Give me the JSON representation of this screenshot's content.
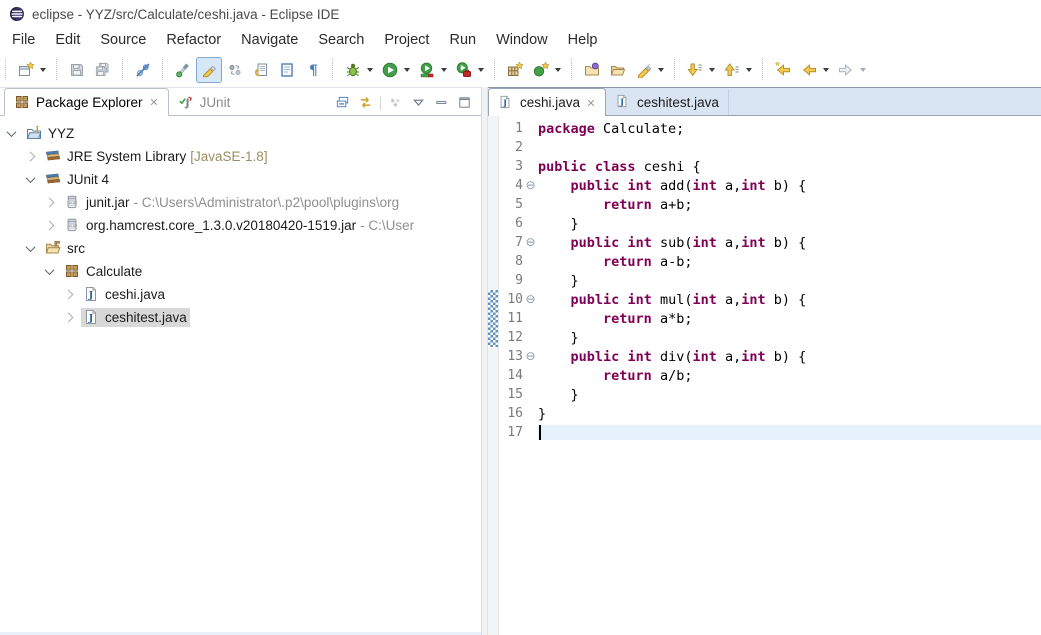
{
  "window": {
    "title": "eclipse - YYZ/src/Calculate/ceshi.java - Eclipse IDE"
  },
  "menubar": [
    "File",
    "Edit",
    "Source",
    "Refactor",
    "Navigate",
    "Search",
    "Project",
    "Run",
    "Window",
    "Help"
  ],
  "toolbar": {
    "groups": [
      [
        {
          "name": "new-wizard-icon",
          "dropdown": true
        }
      ],
      [
        {
          "name": "save-icon",
          "disabled": true
        },
        {
          "name": "save-all-icon",
          "disabled": true
        }
      ],
      [
        {
          "name": "skip-breakpoints-icon"
        }
      ],
      [
        {
          "name": "flashlight-icon"
        },
        {
          "name": "mark-occurrences-icon",
          "active": true
        },
        {
          "name": "linked-dots-icon"
        },
        {
          "name": "page-arrow-icon"
        },
        {
          "name": "framed-page-icon"
        },
        {
          "name": "pilcrow-icon"
        }
      ],
      [
        {
          "name": "debug-icon",
          "dropdown": true
        },
        {
          "name": "run-icon",
          "dropdown": true
        },
        {
          "name": "coverage-icon",
          "dropdown": true
        },
        {
          "name": "external-tools-icon",
          "dropdown": true
        }
      ],
      [
        {
          "name": "new-java-project-icon"
        },
        {
          "name": "new-class-icon",
          "dropdown": true
        }
      ],
      [
        {
          "name": "open-type-icon"
        },
        {
          "name": "open-folder-icon"
        },
        {
          "name": "search-icon",
          "dropdown": true
        }
      ],
      [
        {
          "name": "next-annotation-icon",
          "dropdown": true
        },
        {
          "name": "previous-annotation-icon",
          "dropdown": true
        }
      ],
      [
        {
          "name": "last-edit-location-icon"
        },
        {
          "name": "back-icon",
          "dropdown": true
        },
        {
          "name": "forward-icon",
          "dropdown": true,
          "disabled": true
        }
      ]
    ]
  },
  "package_explorer": {
    "tabs": [
      {
        "label": "Package Explorer",
        "icon": "package-explorer-icon",
        "active": true,
        "closable": true
      },
      {
        "label": "JUnit",
        "icon": "junit-icon",
        "active": false
      }
    ],
    "view_buttons": [
      {
        "name": "collapse-all-icon"
      },
      {
        "name": "link-with-editor-icon"
      },
      {
        "sep": true
      },
      {
        "name": "focus-icon",
        "disabled": true
      },
      {
        "name": "view-menu-icon"
      },
      {
        "name": "minimize-icon"
      },
      {
        "name": "maximize-icon"
      }
    ],
    "tree": [
      {
        "label": "YYZ",
        "icon": "java-project-icon",
        "level": 0,
        "expanded": true
      },
      {
        "label": "JRE System Library",
        "decor": " [JavaSE-1.8]",
        "icon": "library-icon",
        "level": 1,
        "expanded": false
      },
      {
        "label": "JUnit 4",
        "icon": "library-icon",
        "level": 1,
        "expanded": true
      },
      {
        "label": "junit.jar",
        "qualifier": " - C:\\Users\\Administrator\\.p2\\pool\\plugins\\org",
        "icon": "jar-icon",
        "level": 2,
        "expanded": false
      },
      {
        "label": "org.hamcrest.core_1.3.0.v20180420-1519.jar",
        "qualifier": " - C:\\User",
        "icon": "jar-icon",
        "level": 2,
        "expanded": false
      },
      {
        "label": "src",
        "icon": "src-folder-icon",
        "level": 1,
        "expanded": true
      },
      {
        "label": "Calculate",
        "icon": "package-icon",
        "level": 2,
        "expanded": true
      },
      {
        "label": "ceshi.java",
        "icon": "java-file-icon",
        "level": 3,
        "expanded": false
      },
      {
        "label": "ceshitest.java",
        "icon": "java-file-icon",
        "level": 3,
        "expanded": false,
        "selected": true
      }
    ]
  },
  "editor": {
    "tabs": [
      {
        "label": "ceshi.java",
        "icon": "java-file-icon",
        "active": true,
        "closable": true
      },
      {
        "label": "ceshitest.java",
        "icon": "java-file-icon",
        "active": false
      }
    ],
    "cursor_line": 17,
    "current_line": 17,
    "fold_lines": [
      4,
      7,
      10,
      13
    ],
    "range_indicator": {
      "from": 10,
      "to": 12
    },
    "lines": [
      {
        "segs": [
          [
            "package",
            "k"
          ],
          [
            " Calculate;",
            "p"
          ]
        ]
      },
      {
        "segs": []
      },
      {
        "segs": [
          [
            "public",
            "k"
          ],
          [
            " ",
            "p"
          ],
          [
            "class",
            "k"
          ],
          [
            " ceshi {",
            "p"
          ]
        ]
      },
      {
        "segs": [
          [
            "    ",
            "p"
          ],
          [
            "public",
            "k"
          ],
          [
            " ",
            "p"
          ],
          [
            "int",
            "k"
          ],
          [
            " add(",
            "p"
          ],
          [
            "int",
            "k"
          ],
          [
            " a,",
            "p"
          ],
          [
            "int",
            "k"
          ],
          [
            " b) {",
            "p"
          ]
        ]
      },
      {
        "segs": [
          [
            "        ",
            "p"
          ],
          [
            "return",
            "k"
          ],
          [
            " a+b;",
            "p"
          ]
        ]
      },
      {
        "segs": [
          [
            "    }",
            "p"
          ]
        ]
      },
      {
        "segs": [
          [
            "    ",
            "p"
          ],
          [
            "public",
            "k"
          ],
          [
            " ",
            "p"
          ],
          [
            "int",
            "k"
          ],
          [
            " sub(",
            "p"
          ],
          [
            "int",
            "k"
          ],
          [
            " a,",
            "p"
          ],
          [
            "int",
            "k"
          ],
          [
            " b) {",
            "p"
          ]
        ]
      },
      {
        "segs": [
          [
            "        ",
            "p"
          ],
          [
            "return",
            "k"
          ],
          [
            " a-b;",
            "p"
          ]
        ]
      },
      {
        "segs": [
          [
            "    }",
            "p"
          ]
        ]
      },
      {
        "segs": [
          [
            "    ",
            "p"
          ],
          [
            "public",
            "k"
          ],
          [
            " ",
            "p"
          ],
          [
            "int",
            "k"
          ],
          [
            " mul(",
            "p"
          ],
          [
            "int",
            "k"
          ],
          [
            " a,",
            "p"
          ],
          [
            "int",
            "k"
          ],
          [
            " b) {",
            "p"
          ]
        ]
      },
      {
        "segs": [
          [
            "        ",
            "p"
          ],
          [
            "return",
            "k"
          ],
          [
            " a*b;",
            "p"
          ]
        ]
      },
      {
        "segs": [
          [
            "    }",
            "p"
          ]
        ]
      },
      {
        "segs": [
          [
            "    ",
            "p"
          ],
          [
            "public",
            "k"
          ],
          [
            " ",
            "p"
          ],
          [
            "int",
            "k"
          ],
          [
            " div(",
            "p"
          ],
          [
            "int",
            "k"
          ],
          [
            " a,",
            "p"
          ],
          [
            "int",
            "k"
          ],
          [
            " b) {",
            "p"
          ]
        ]
      },
      {
        "segs": [
          [
            "        ",
            "p"
          ],
          [
            "return",
            "k"
          ],
          [
            " a/b;",
            "p"
          ]
        ]
      },
      {
        "segs": [
          [
            "    }",
            "p"
          ]
        ]
      },
      {
        "segs": [
          [
            "}",
            "p"
          ]
        ]
      },
      {
        "segs": []
      }
    ]
  },
  "colors": {
    "keyword": "#7f0055",
    "current_line_bg": "#e6f1fb",
    "tree_selection_bg": "#d8d8d8",
    "editor_tabstrip_bg": "#d9e5f3",
    "range_indicator": "#5f93be",
    "line_number": "#7a7a7a",
    "qualifier_text": "#8f8f8f",
    "decorator_text": "#9c8e62"
  }
}
